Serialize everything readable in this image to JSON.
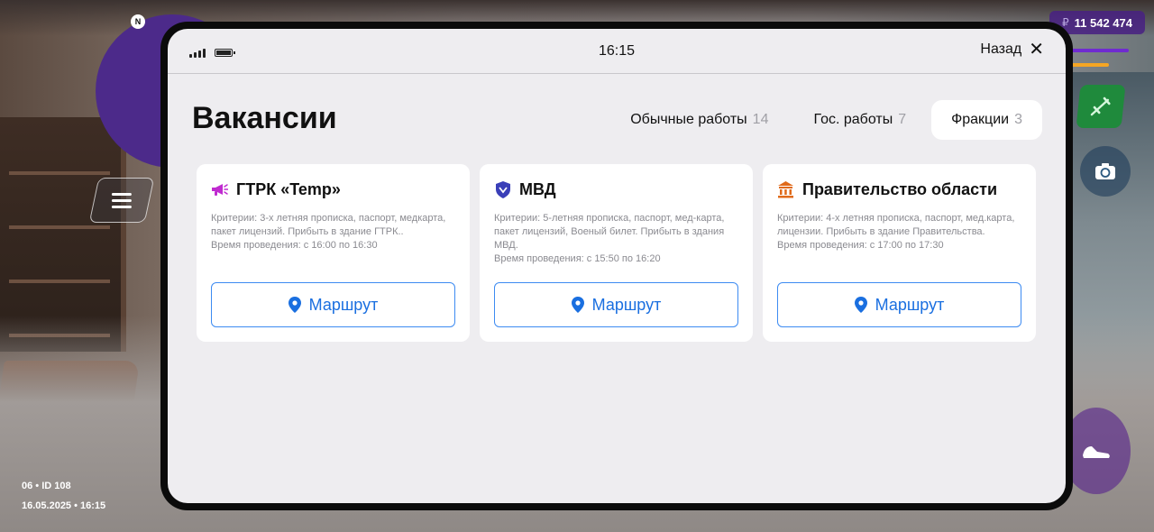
{
  "hud": {
    "compass_label": "N",
    "money_symbol": "₽",
    "money_amount": "11 542 474",
    "id_line": "06 • ID 108",
    "date_line": "16.05.2025 • 16:15"
  },
  "status_bar": {
    "time": "16:15",
    "back_label": "Назад",
    "close_icon": "close-icon"
  },
  "page": {
    "title": "Вакансии"
  },
  "tabs": [
    {
      "label": "Обычные работы",
      "count": "14",
      "active": false
    },
    {
      "label": "Гос. работы",
      "count": "7",
      "active": false
    },
    {
      "label": "Фракции",
      "count": "3",
      "active": true
    }
  ],
  "cards": [
    {
      "icon": "megaphone-icon",
      "icon_color": "#c02bd0",
      "title": "ГТРК «Temp»",
      "criteria": "Критерии: 3-х летняя прописка, паспорт, медкарта, пакет лицензий. Прибыть в здание ГТРК..",
      "time": "Время проведения: с 16:00 по 16:30",
      "route_label": "Маршрут"
    },
    {
      "icon": "shield-icon",
      "icon_color": "#3a3fb8",
      "title": "МВД",
      "criteria": "Критерии: 5-летняя прописка, паспорт, мед-карта, пакет лицензий, Военый билет. Прибыть в здания МВД.",
      "time": "Время проведения: с 15:50 по 16:20",
      "route_label": "Маршрут"
    },
    {
      "icon": "government-building-icon",
      "icon_color": "#e06a1a",
      "title": "Правительство области",
      "criteria": "Критерии: 4-х летняя прописка, паспорт, мед.карта, лицензии. Прибыть в здание Правительства.",
      "time": "Время проведения: с 17:00 по 17:30",
      "route_label": "Маршрут"
    }
  ],
  "colors": {
    "accent_blue": "#1a6fe0",
    "route_border": "#3d8bf2",
    "screen_bg": "#eeedf0",
    "hud_purple": "#4c2a8a"
  }
}
